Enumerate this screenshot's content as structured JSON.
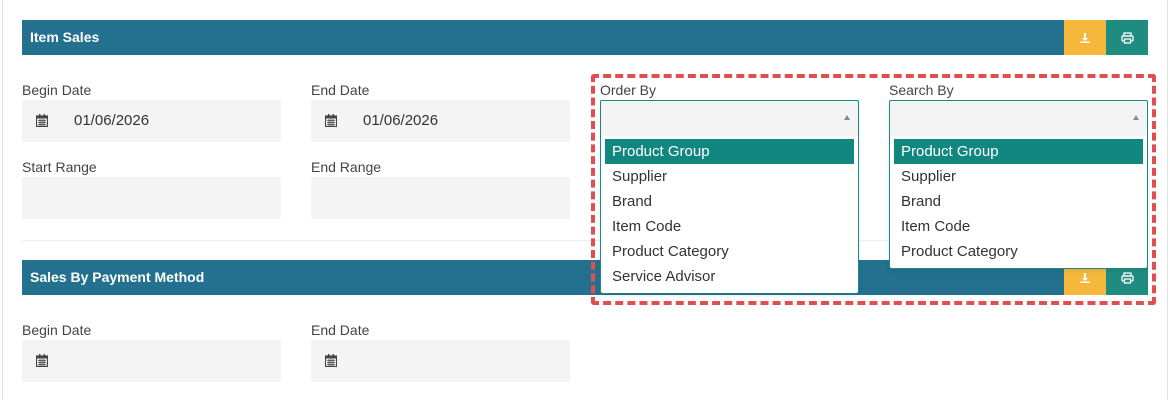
{
  "item_sales": {
    "title": "Item Sales",
    "begin_date_label": "Begin Date",
    "begin_date_value": "01/06/2026",
    "end_date_label": "End Date",
    "end_date_value": "01/06/2026",
    "start_range_label": "Start Range",
    "end_range_label": "End Range",
    "order_by": {
      "label": "Order By",
      "value": "",
      "options": [
        "Product Group",
        "Supplier",
        "Brand",
        "Item Code",
        "Product Category",
        "Service Advisor"
      ],
      "highlighted": "Product Group"
    },
    "search_by": {
      "label": "Search By",
      "value": "",
      "options": [
        "Product Group",
        "Supplier",
        "Brand",
        "Item Code",
        "Product Category"
      ],
      "highlighted": "Product Group"
    }
  },
  "sales_by_payment": {
    "title": "Sales By Payment Method",
    "begin_date_label": "Begin Date",
    "begin_date_value": "",
    "end_date_label": "End Date",
    "end_date_value": ""
  },
  "icons": {
    "download": "download-icon",
    "print": "print-icon",
    "calendar": "calendar-icon"
  },
  "colors": {
    "header": "#23708f",
    "download_button": "#f5b83d",
    "print_button": "#1e8c7f",
    "option_highlight": "#12877f",
    "annotation": "#e04f4f"
  }
}
